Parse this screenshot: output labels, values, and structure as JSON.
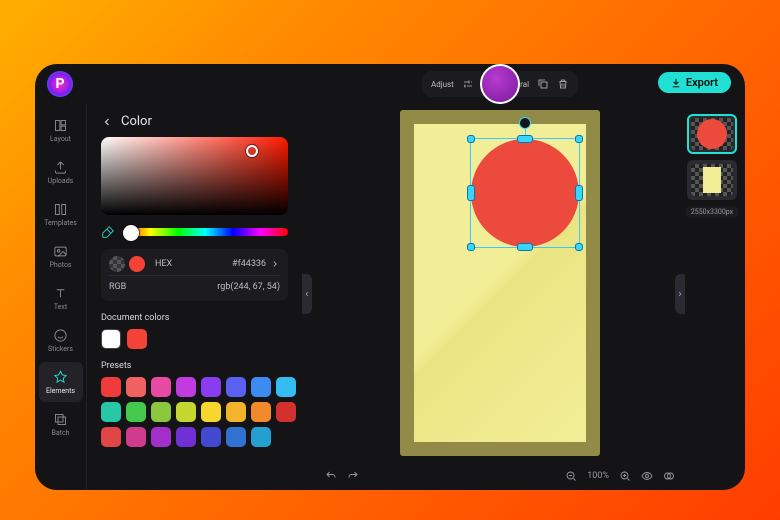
{
  "logo_letter": "P",
  "export_label": "Export",
  "rail": [
    {
      "id": "layout",
      "label": "Layout"
    },
    {
      "id": "uploads",
      "label": "Uploads"
    },
    {
      "id": "templates",
      "label": "Templates"
    },
    {
      "id": "photos",
      "label": "Photos"
    },
    {
      "id": "text",
      "label": "Text"
    },
    {
      "id": "stickers",
      "label": "Stickers"
    },
    {
      "id": "elements",
      "label": "Elements"
    },
    {
      "id": "batch",
      "label": "Batch"
    }
  ],
  "panel": {
    "title": "Color",
    "hex_label": "HEX",
    "hex_value": "#f44336",
    "rgb_label": "RGB",
    "rgb_value": "rgb(244, 67, 54)",
    "doc_title": "Document colors",
    "doc_colors": [
      "#ffffff",
      "#f44336"
    ],
    "presets_title": "Presets",
    "presets": [
      "#ef3b3b",
      "#f06262",
      "#e64aa2",
      "#c23be0",
      "#8a3cf0",
      "#5a60ef",
      "#3b8bf0",
      "#33bdf2",
      "#28c7a8",
      "#45c94c",
      "#8ac73e",
      "#c6d631",
      "#f7d62e",
      "#f3b32b",
      "#f28a2b",
      "#d22f2f",
      "#e04646",
      "#cf3b8d",
      "#a32fcb",
      "#7130d6",
      "#4348d0",
      "#2f72d1",
      "#249fcf"
    ]
  },
  "context": {
    "adjust_label": "Adjust",
    "general_label": "General"
  },
  "status": {
    "zoom": "100%"
  },
  "layers": {
    "dimensions": "2550x3300px"
  },
  "colors": {
    "selected": "#f44336",
    "paper": "#f2ee98"
  }
}
